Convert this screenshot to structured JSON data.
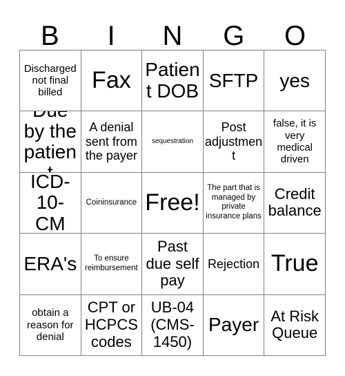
{
  "card": {
    "type": "bingo-card",
    "columns": 5,
    "rows": 5,
    "header": {
      "letters": [
        "B",
        "I",
        "N",
        "G",
        "O"
      ]
    },
    "grid": [
      [
        {
          "text": "Discharged not final billed",
          "size": "sm"
        },
        {
          "text": "Fax",
          "size": "xxl"
        },
        {
          "text": "Patient DOB",
          "size": "xl"
        },
        {
          "text": "SFTP",
          "size": "xl"
        },
        {
          "text": "yes",
          "size": "xl"
        }
      ],
      [
        {
          "text": "Due by the patient",
          "size": "xl"
        },
        {
          "text": "A denial sent from the payer",
          "size": "md"
        },
        {
          "text": "sequestration",
          "size": "xxs"
        },
        {
          "text": "Post adjustment",
          "size": "md"
        },
        {
          "text": "false, it is very medical driven",
          "size": "sm"
        }
      ],
      [
        {
          "text": "ICD-10-CM",
          "size": "xl"
        },
        {
          "text": "Coininsurance",
          "size": "xs"
        },
        {
          "text": "Free!",
          "size": "xxl"
        },
        {
          "text": "The part that is managed by private insurance plans",
          "size": "xs"
        },
        {
          "text": "Credit balance",
          "size": "lg"
        }
      ],
      [
        {
          "text": "ERA's",
          "size": "xl"
        },
        {
          "text": "To ensure reimbursement",
          "size": "xs"
        },
        {
          "text": "Past due self pay",
          "size": "lg"
        },
        {
          "text": "Rejection",
          "size": "md"
        },
        {
          "text": "True",
          "size": "xxl"
        }
      ],
      [
        {
          "text": "obtain a reason for denial",
          "size": "sm"
        },
        {
          "text": "CPT or HCPCS codes",
          "size": "lg"
        },
        {
          "text": "UB-04 (CMS-1450)",
          "size": "lg"
        },
        {
          "text": "Payer",
          "size": "xl"
        },
        {
          "text": "At Risk Queue",
          "size": "lg"
        }
      ]
    ],
    "colors": {
      "background": "#ffffff",
      "text": "#000000",
      "gridline": "#808080"
    }
  }
}
